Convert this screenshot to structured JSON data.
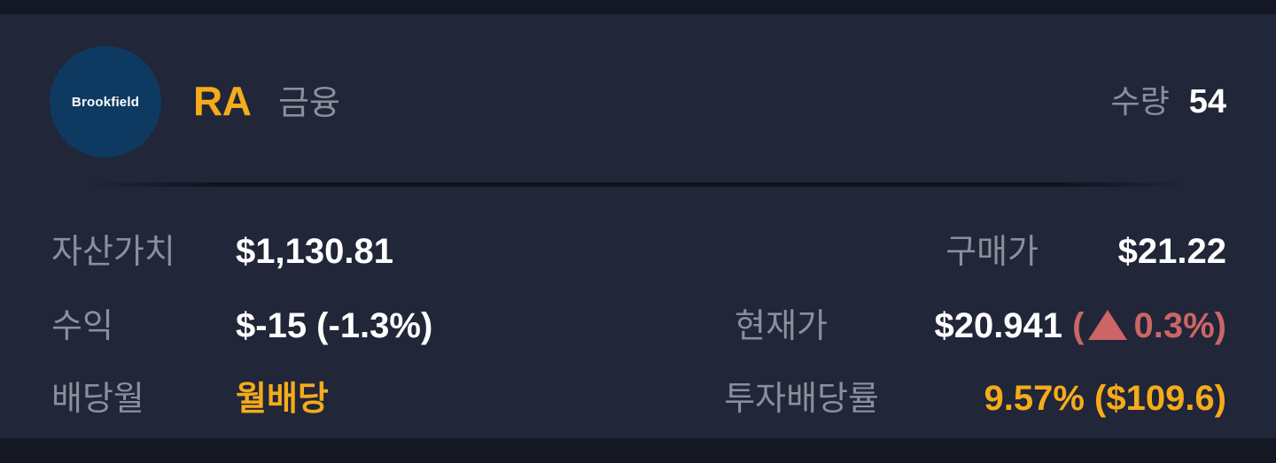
{
  "stock": {
    "logo_text": "Brookfield",
    "ticker": "RA",
    "sector": "금융",
    "quantity_label": "수량",
    "quantity_value": "54"
  },
  "details": {
    "asset_value_label": "자산가치",
    "asset_value": "$1,130.81",
    "purchase_price_label": "구매가",
    "purchase_price": "$21.22",
    "profit_label": "수익",
    "profit": "$-15 (-1.3%)",
    "current_price_label": "현재가",
    "current_price": "$20.941",
    "change_open": "(",
    "change_icon": "triangle-up-icon",
    "change_percent": "0.3%)",
    "dividend_month_label": "배당월",
    "dividend_month": "월배당",
    "dividend_yield_label": "투자배당률",
    "dividend_yield": "9.57% ($109.6)"
  },
  "colors": {
    "background": "#141824",
    "card": "#212638",
    "accent": "#f5ab1b",
    "up": "#cc6566",
    "label": "#8b8f9c",
    "logo_bg": "#0e3a61"
  }
}
